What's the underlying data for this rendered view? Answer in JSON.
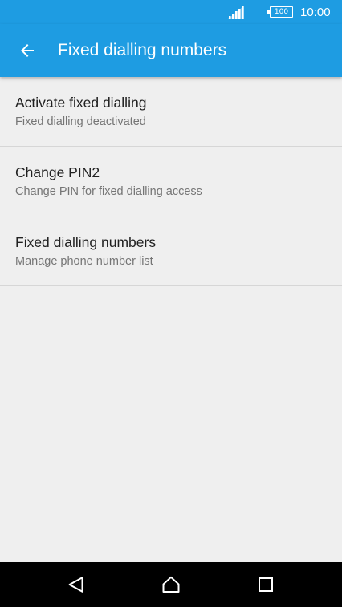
{
  "status_bar": {
    "battery_level": "100",
    "time": "10:00",
    "signal_icon": "signal-bars-icon",
    "battery_icon": "battery-icon"
  },
  "app_bar": {
    "title": "Fixed dialling numbers",
    "back_icon": "arrow-left-icon",
    "color": "#1e9ce2"
  },
  "settings": {
    "items": [
      {
        "title": "Activate fixed dialling",
        "summary": "Fixed dialling deactivated"
      },
      {
        "title": "Change PIN2",
        "summary": "Change PIN for fixed dialling access"
      },
      {
        "title": "Fixed dialling numbers",
        "summary": "Manage phone number list"
      }
    ]
  },
  "navigation_bar": {
    "buttons": [
      {
        "icon": "triangle-back-icon"
      },
      {
        "icon": "circle-home-icon"
      },
      {
        "icon": "square-recents-icon"
      }
    ]
  }
}
